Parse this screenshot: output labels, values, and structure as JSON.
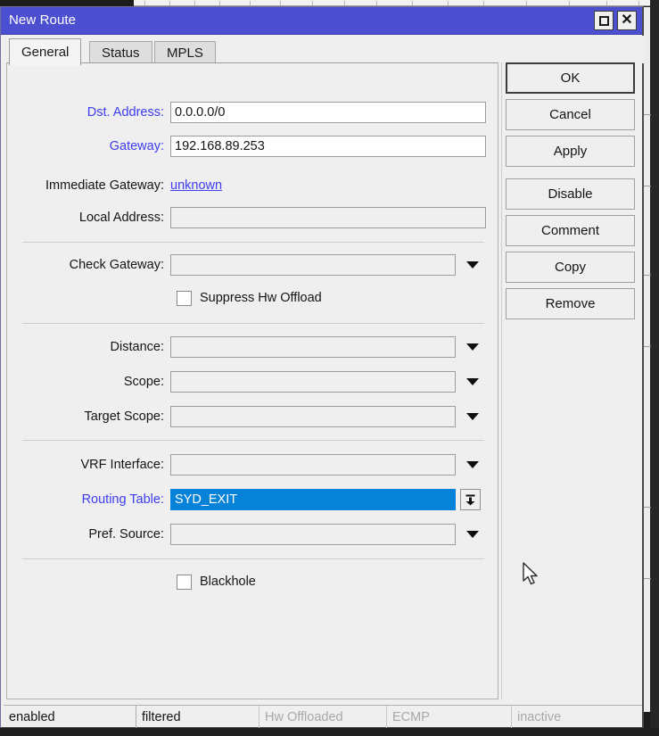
{
  "window": {
    "title": "New Route",
    "restore_icon": "restore-icon",
    "close_icon": "close-icon",
    "titlebar_color": "#4c4fd0"
  },
  "tabs": [
    {
      "label": "General",
      "active": true
    },
    {
      "label": "Status",
      "active": false
    },
    {
      "label": "MPLS",
      "active": false
    }
  ],
  "form": {
    "dst_address": {
      "label": "Dst. Address:",
      "value": "0.0.0.0/0",
      "label_color": "#3c3cf0"
    },
    "gateway": {
      "label": "Gateway:",
      "value": "192.168.89.253",
      "label_color": "#3c3cf0"
    },
    "immediate_gateway": {
      "label": "Immediate Gateway:",
      "value": "unknown"
    },
    "local_address": {
      "label": "Local Address:",
      "value": ""
    },
    "check_gateway": {
      "label": "Check Gateway:",
      "value": ""
    },
    "suppress_hw_offload": {
      "label": "Suppress Hw Offload",
      "checked": false
    },
    "distance": {
      "label": "Distance:",
      "value": ""
    },
    "scope": {
      "label": "Scope:",
      "value": ""
    },
    "target_scope": {
      "label": "Target Scope:",
      "value": ""
    },
    "vrf_interface": {
      "label": "VRF Interface:",
      "value": ""
    },
    "routing_table": {
      "label": "Routing Table:",
      "value": "SYD_EXIT",
      "label_color": "#3c3cf0",
      "selected": true,
      "selection_color": "#0682d9"
    },
    "pref_source": {
      "label": "Pref. Source:",
      "value": ""
    },
    "blackhole": {
      "label": "Blackhole",
      "checked": false
    }
  },
  "buttons": [
    {
      "label": "OK",
      "focused": true
    },
    {
      "label": "Cancel",
      "focused": false
    },
    {
      "label": "Apply",
      "focused": false
    },
    {
      "label": "Disable",
      "focused": false
    },
    {
      "label": "Comment",
      "focused": false
    },
    {
      "label": "Copy",
      "focused": false
    },
    {
      "label": "Remove",
      "focused": false
    }
  ],
  "statusbar": [
    {
      "label": "enabled",
      "enabled": true
    },
    {
      "label": "filtered",
      "enabled": true
    },
    {
      "label": "Hw Offloaded",
      "enabled": false
    },
    {
      "label": "ECMP",
      "enabled": false
    },
    {
      "label": "inactive",
      "enabled": false
    }
  ]
}
